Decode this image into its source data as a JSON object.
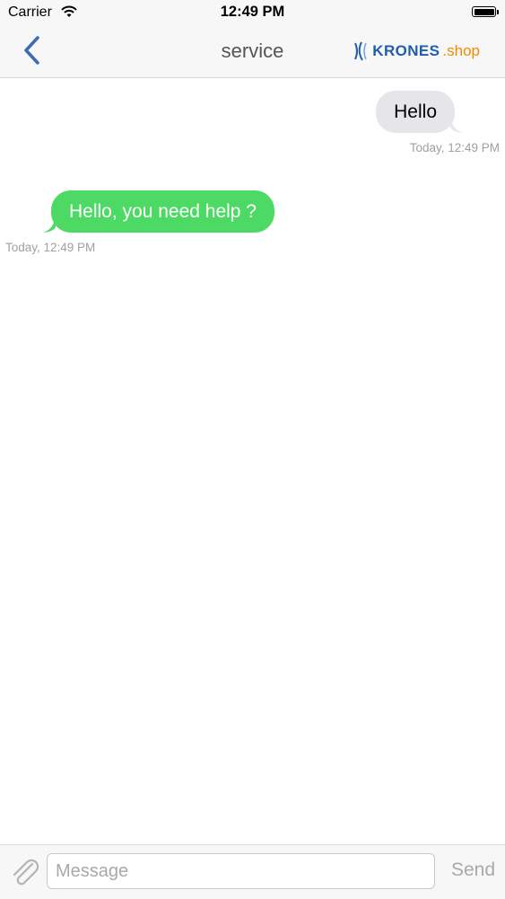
{
  "status_bar": {
    "carrier": "Carrier",
    "time": "12:49 PM",
    "wifi_icon": "wifi-icon",
    "battery_icon": "battery-icon",
    "battery_level": 1.0
  },
  "nav": {
    "back_icon": "chevron-left-icon",
    "title": "service",
    "logo": {
      "brand": "KRONES",
      "suffix": ".shop"
    }
  },
  "messages": [
    {
      "direction": "outgoing",
      "text": "Hello",
      "timestamp": "Today, 12:49 PM"
    },
    {
      "direction": "incoming",
      "text": "Hello, you need help ?",
      "timestamp": "Today, 12:49 PM"
    }
  ],
  "composer": {
    "attach_icon": "paperclip-icon",
    "placeholder": "Message",
    "value": "",
    "send_label": "Send"
  },
  "colors": {
    "accent": "#3f6bb5",
    "incoming_bubble": "#4cd964",
    "outgoing_bubble": "#e6e5ea",
    "timestamp": "#a0a0a5",
    "bar_background": "#f7f7f7"
  }
}
